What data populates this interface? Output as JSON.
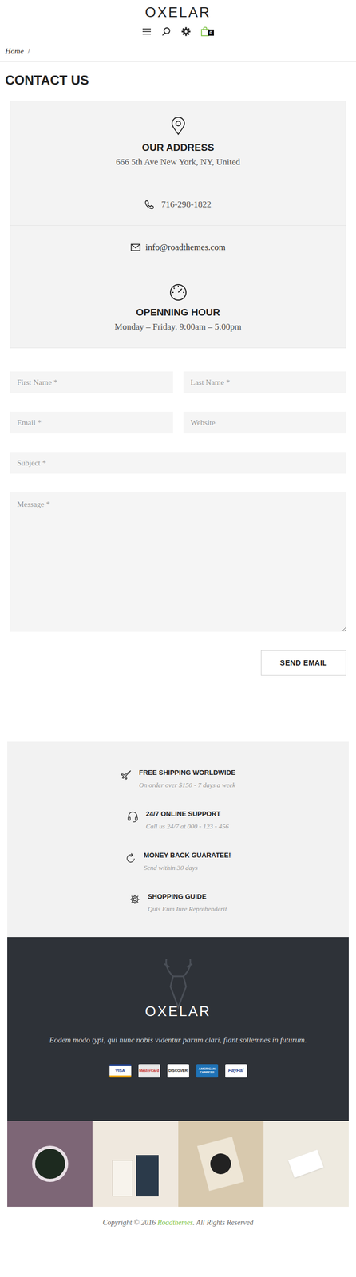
{
  "header": {
    "logo": "OXELAR",
    "cart_count": "0"
  },
  "breadcrumb": {
    "home": "Home",
    "separator": "/"
  },
  "page_title": "CONTACT US",
  "contact_info": {
    "address_title": "OUR ADDRESS",
    "address": "666 5th Ave New York, NY, United",
    "phone": "716-298-1822",
    "email": "info@roadthemes.com",
    "hours_title": "OPENNING HOUR",
    "hours": "Monday – Friday. 9:00am – 5:00pm"
  },
  "form": {
    "first_name": "First Name *",
    "last_name": "Last Name *",
    "email": "Email *",
    "website": "Website",
    "subject": "Subject *",
    "message": "Message *",
    "submit": "SEND EMAIL"
  },
  "features": [
    {
      "title": "FREE SHIPPING WORLDWIDE",
      "subtitle": "On order over $150 - 7 days a week",
      "kind": "plane"
    },
    {
      "title": "24/7 ONLINE SUPPORT",
      "subtitle": "Call us 24/7 at 000 - 123 - 456",
      "kind": "headset"
    },
    {
      "title": "MONEY BACK GUARATEE!",
      "subtitle": "Send within 30 days",
      "kind": "refresh"
    },
    {
      "title": "SHOPPING GUIDE",
      "subtitle": "Quis Eum Iure Reprehenderit",
      "kind": "gear"
    }
  ],
  "footer": {
    "logo": "OXELAR",
    "tagline": "Eodem modo typi, qui nunc nobis videntur parum clari, fiant sollemnes in futurum.",
    "payments": [
      "VISA",
      "MasterCard",
      "DISCOVER",
      "AMERICAN EXPRESS",
      "PayPal"
    ]
  },
  "copyright": {
    "prefix": "Copyright © 2016 ",
    "brand": "Roadthemes",
    "suffix": ". All Rights Reserved"
  }
}
